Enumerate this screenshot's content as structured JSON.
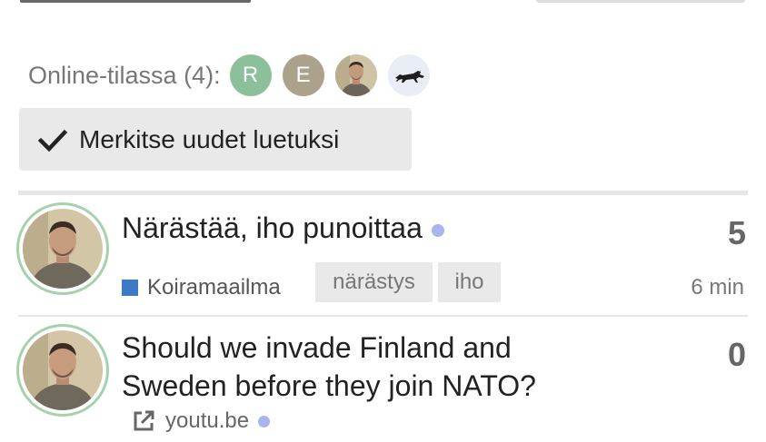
{
  "online": {
    "label": "Online-tilassa (4):",
    "users": [
      {
        "letter": "R",
        "color": "#8cc09a"
      },
      {
        "letter": "E",
        "color": "#aca28c"
      }
    ]
  },
  "mark_read_button": {
    "label": "Merkitse uudet luetuksi"
  },
  "topics": [
    {
      "title": "Närästää, iho punoittaa",
      "category": "Koiramaailma",
      "category_color": "#3c7ac7",
      "tags": [
        "närästys",
        "iho"
      ],
      "replies": "5",
      "age": "6 min"
    },
    {
      "title_line1": "Should we invade Finland and",
      "title_line2": "Sweden before they join NATO?",
      "link_domain": "youtu.be",
      "replies": "0"
    }
  ],
  "colors": {
    "new_dot": "#a9b4f0",
    "avatar_ring": "#a5d2ad",
    "tag_bg": "#e9e9e9"
  }
}
